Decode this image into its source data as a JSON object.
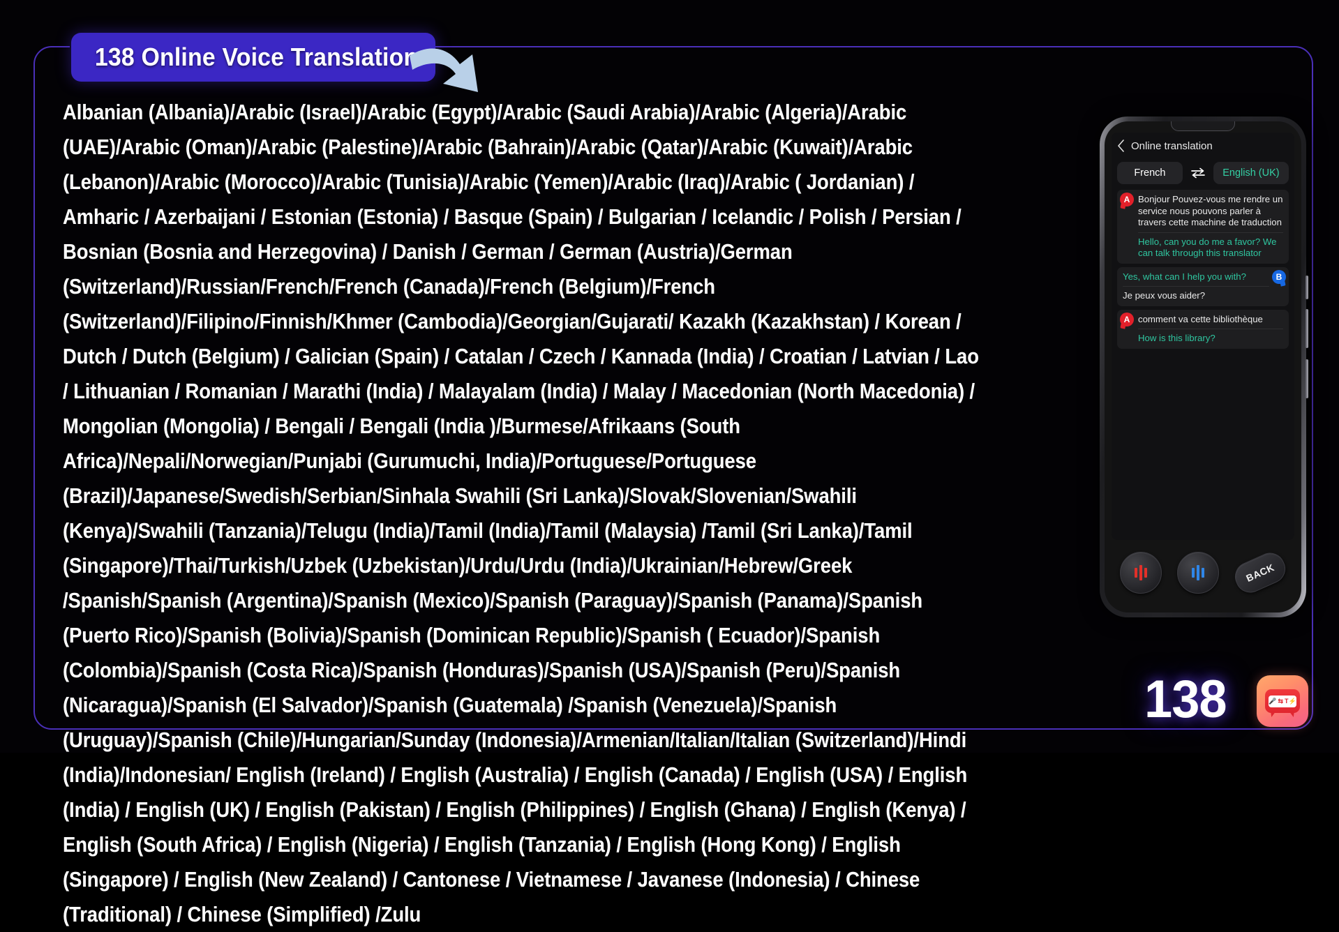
{
  "banner": {
    "title": "138 Online Voice Translation",
    "badge_color": "#3b27c4",
    "arrow_color": "#b9d0e8",
    "arrow_icon": "curved-arrow-icon"
  },
  "frame": {
    "border_color": "#4a2fb8"
  },
  "languages": {
    "text": "Albanian (Albania)/Arabic (Israel)/Arabic (Egypt)/Arabic (Saudi Arabia)/Arabic (Algeria)/Arabic (UAE)/Arabic (Oman)/Arabic (Palestine)/Arabic (Bahrain)/Arabic (Qatar)/Arabic (Kuwait)/Arabic (Lebanon)/Arabic (Morocco)/Arabic (Tunisia)/Arabic (Yemen)/Arabic (Iraq)/Arabic ( Jordanian) / Amharic / Azerbaijani / Estonian (Estonia) / Basque (Spain) / Bulgarian / Icelandic / Polish / Persian / Bosnian (Bosnia and Herzegovina) / Danish / German / German (Austria)/German (Switzerland)/Russian/French/French (Canada)/French (Belgium)/French (Switzerland)/Filipino/Finnish/Khmer (Cambodia)/Georgian/Gujarati/ Kazakh (Kazakhstan) / Korean / Dutch / Dutch (Belgium) / Galician (Spain) / Catalan / Czech / Kannada (India) / Croatian / Latvian / Lao / Lithuanian / Romanian / Marathi (India) / Malayalam (India) / Malay / Macedonian (North Macedonia) / Mongolian (Mongolia) / Bengali / Bengali (India )/Burmese/Afrikaans (South Africa)/Nepali/Norwegian/Punjabi (Gurumuchi, India)/Portuguese/Portuguese (Brazil)/Japanese/Swedish/Serbian/Sinhala Swahili (Sri Lanka)/Slovak/Slovenian/Swahili (Kenya)/Swahili (Tanzania)/Telugu (India)/Tamil (India)/Tamil (Malaysia) /Tamil (Sri Lanka)/Tamil (Singapore)/Thai/Turkish/Uzbek (Uzbekistan)/Urdu/Urdu (India)/Ukrainian/Hebrew/Greek /Spanish/Spanish (Argentina)/Spanish (Mexico)/Spanish (Paraguay)/Spanish (Panama)/Spanish (Puerto Rico)/Spanish (Bolivia)/Spanish (Dominican Republic)/Spanish ( Ecuador)/Spanish (Colombia)/Spanish (Costa Rica)/Spanish (Honduras)/Spanish (USA)/Spanish (Peru)/Spanish (Nicaragua)/Spanish (El Salvador)/Spanish (Guatemala) /Spanish (Venezuela)/Spanish (Uruguay)/Spanish (Chile)/Hungarian/Sunday (Indonesia)/Armenian/Italian/Italian (Switzerland)/Hindi (India)/Indonesian/ English (Ireland) / English (Australia) / English (Canada) / English (USA) / English (India) / English (UK) / English (Pakistan) / English (Philippines) / English (Ghana) / English (Kenya) / English (South Africa) / English (Nigeria) / English (Tanzania) / English (Hong Kong) / English (Singapore) / English (New Zealand) / Cantonese / Vietnamese / Javanese (Indonesia) / Chinese (Traditional) / Chinese (Simplified) /Zulu"
  },
  "phone": {
    "app": {
      "header_title": "Online translation",
      "back_icon": "chevron-left-icon",
      "source_language": "French",
      "target_language": "English (UK)",
      "swap_icon": "swap-arrows-icon",
      "target_color": "#34d0a4"
    },
    "messages": [
      {
        "speaker": "A",
        "original": "Bonjour Pouvez-vous me rendre un service nous pouvons parler à travers cette machine de traduction",
        "translation": "Hello, can you do me a favor? We can talk through this translator"
      },
      {
        "speaker": "B",
        "original": "Yes, what can I help you with?",
        "translation": "Je peux vous aider?"
      },
      {
        "speaker": "A",
        "original": "comment va cette bibliothèque",
        "translation": "How is this library?"
      }
    ],
    "controls": {
      "record_a_icon": "waveform-mic-icon-red",
      "record_b_icon": "waveform-mic-icon-blue",
      "back_label": "BACK",
      "record_a_color": "#e23029",
      "record_b_color": "#2f86e8"
    }
  },
  "footer": {
    "count": "138",
    "logo_icon": "translator-app-icon",
    "logo_glyphs": [
      "mic",
      "⇄",
      "T"
    ]
  }
}
